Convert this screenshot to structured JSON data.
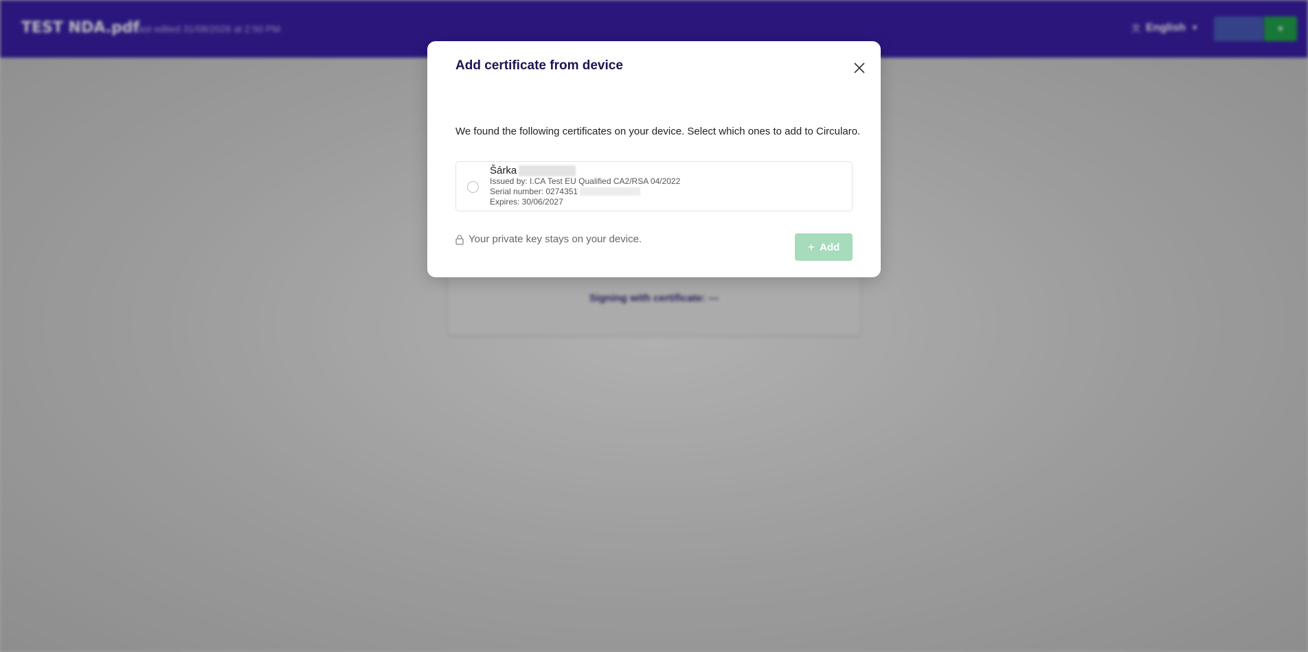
{
  "header": {
    "doc_title": "TEST NDA.pdf",
    "last_edited": "Last edited 31/08/2026 at 2:50 PM",
    "language": "English"
  },
  "background": {
    "signing_text": "Signing with certificate: ---"
  },
  "modal": {
    "title": "Add certificate from device",
    "intro": "We found the following certificates on your device. Select which ones to add to Circularo.",
    "certificate": {
      "name": "Šárka",
      "issued_by": "Issued by: I.CA Test EU Qualified CA2/RSA 04/2022",
      "serial": "Serial number: 0274351",
      "expires": "Expires: 30/06/2027",
      "selected": false
    },
    "footnote": "Your private key stays on your device.",
    "add_label": "Add",
    "add_color": "#a6dbbb"
  },
  "colors": {
    "header_bg": "#3a1ea6",
    "title_color": "#1e1450"
  }
}
